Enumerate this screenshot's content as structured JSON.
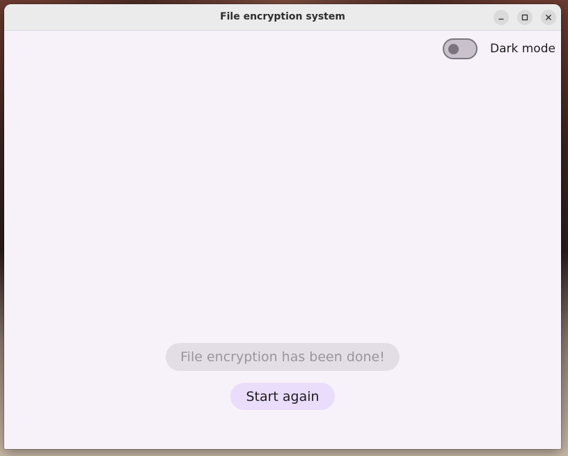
{
  "window": {
    "title": "File encryption system",
    "controls": {
      "minimize_icon": "minimize-icon",
      "maximize_icon": "maximize-icon",
      "close_icon": "close-icon"
    }
  },
  "toolbar": {
    "dark_mode_label": "Dark mode",
    "dark_mode_enabled": false
  },
  "main": {
    "status_message": "File encryption has been done!",
    "start_again_label": "Start again"
  },
  "colors": {
    "background": "#f7f2f9",
    "accent_button": "#e9ddfb",
    "status_pill": "#e3dde5",
    "toggle_track": "#c9c2cc",
    "toggle_outline": "#79747e"
  }
}
